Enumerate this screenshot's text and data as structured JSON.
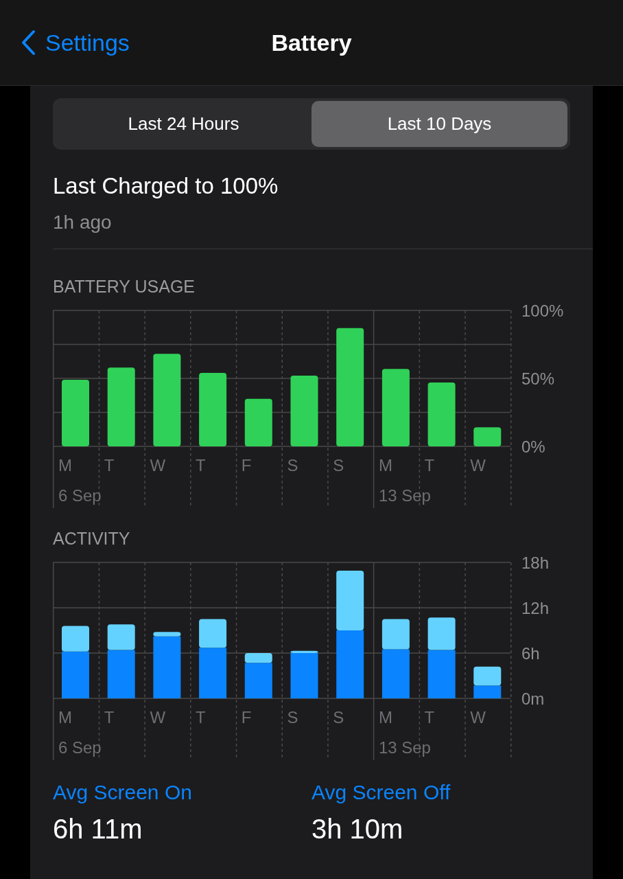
{
  "nav": {
    "back": "Settings",
    "title": "Battery"
  },
  "segments": [
    {
      "label": "Last 24 Hours",
      "selected": false
    },
    {
      "label": "Last 10 Days",
      "selected": true
    }
  ],
  "last_charged": {
    "title": "Last Charged to 100%",
    "time": "1h ago"
  },
  "battery_usage": {
    "title": "BATTERY USAGE",
    "weeks": [
      {
        "label": "6 Sep",
        "days": [
          "M",
          "T",
          "W",
          "T",
          "F",
          "S",
          "S"
        ]
      },
      {
        "label": "13 Sep",
        "days": [
          "M",
          "T",
          "W"
        ]
      }
    ],
    "chart_data": {
      "type": "bar",
      "series": [
        {
          "color": "#30d158",
          "values": [
            49,
            58,
            68,
            54,
            35,
            52,
            87,
            57,
            47,
            14
          ]
        }
      ],
      "ylim": [
        0,
        100
      ],
      "yticks": [
        {
          "value": 0,
          "label": "0%"
        },
        {
          "value": 50,
          "label": "50%"
        },
        {
          "value": 100,
          "label": "100%"
        }
      ]
    }
  },
  "activity": {
    "title": "ACTIVITY",
    "weeks": [
      {
        "label": "6 Sep",
        "days": [
          "M",
          "T",
          "W",
          "T",
          "F",
          "S",
          "S"
        ]
      },
      {
        "label": "13 Sep",
        "days": [
          "M",
          "T",
          "W"
        ]
      }
    ],
    "chart_data": {
      "type": "bar",
      "stacked": true,
      "series": [
        {
          "color": "#0a84ff",
          "values": [
            6.2,
            6.4,
            8.2,
            6.7,
            4.7,
            6.0,
            9.0,
            6.5,
            6.4,
            1.7
          ]
        },
        {
          "color": "#64d2ff",
          "values": [
            3.4,
            3.4,
            0.6,
            3.8,
            1.3,
            0.3,
            7.9,
            4.0,
            4.3,
            2.5
          ]
        }
      ],
      "ylim": [
        0,
        18
      ],
      "yticks": [
        {
          "value": 0,
          "label": "0m"
        },
        {
          "value": 6,
          "label": "6h"
        },
        {
          "value": 12,
          "label": "12h"
        },
        {
          "value": 18,
          "label": "18h"
        }
      ]
    }
  },
  "averages": [
    {
      "label": "Avg Screen On",
      "value": "6h 11m"
    },
    {
      "label": "Avg Screen Off",
      "value": "3h 10m"
    }
  ]
}
